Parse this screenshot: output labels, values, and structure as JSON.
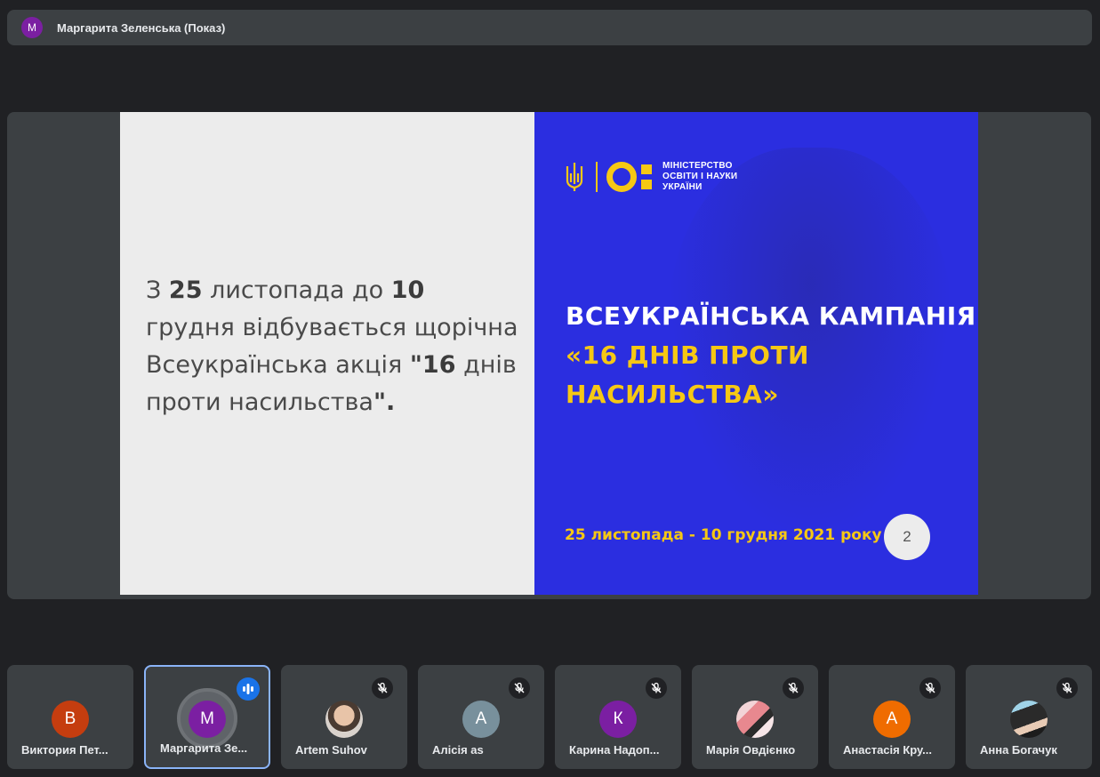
{
  "presenter_bar": {
    "avatar_letter": "М",
    "avatar_color": "#7b1fa2",
    "title": "Маргарита Зеленська (Показ)"
  },
  "slide": {
    "body": {
      "part1": "З ",
      "num1": "25",
      "part2": " листопада до ",
      "num2": "10",
      "part3": " грудня відбувається щорічна Всеукраїнська акція ",
      "quote": "\"16",
      "part4": " днів проти насильства",
      "end": "\"."
    },
    "ministry_logo": {
      "line1": "МІНІСТЕРСТВО",
      "line2": "ОСВІТИ І НАУКИ",
      "line3": "УКРАЇНИ"
    },
    "campaign": {
      "line1": "ВСЕУКРАЇНСЬКА КАМПАНІЯ",
      "line2": "«16 ДНІВ ПРОТИ",
      "line3": "НАСИЛЬСТВА»"
    },
    "date_range": "25 листопада - 10 грудня 2021 року",
    "page_number": "2",
    "colors": {
      "left_bg": "#ececec",
      "right_bg": "#2b2ee0",
      "accent": "#f6c814"
    }
  },
  "participants": [
    {
      "name": "Виктория Пет...",
      "avatar_letter": "В",
      "avatar_color": "#c53d0f",
      "status": "none"
    },
    {
      "name": "Маргарита Зе...",
      "avatar_letter": "М",
      "avatar_color": "#7b1fa2",
      "status": "speaking"
    },
    {
      "name": "Artem Suhov",
      "avatar_letter": "",
      "avatar_type": "photo",
      "status": "muted"
    },
    {
      "name": "Алісія as",
      "avatar_letter": "А",
      "avatar_color": "#78909c",
      "status": "muted"
    },
    {
      "name": "Карина Надоп...",
      "avatar_letter": "К",
      "avatar_color": "#7b1fa2",
      "status": "muted"
    },
    {
      "name": "Марія Овдієнко",
      "avatar_letter": "",
      "avatar_type": "photo",
      "status": "muted"
    },
    {
      "name": "Анастасія Кру...",
      "avatar_letter": "А",
      "avatar_color": "#ef6c00",
      "status": "muted"
    },
    {
      "name": "Анна Богачук",
      "avatar_letter": "",
      "avatar_type": "photo",
      "status": "muted"
    }
  ],
  "icons": {
    "muted": "mic-off-icon",
    "speaking": "audio-level-icon",
    "coat_of_arms": "trident-icon"
  }
}
